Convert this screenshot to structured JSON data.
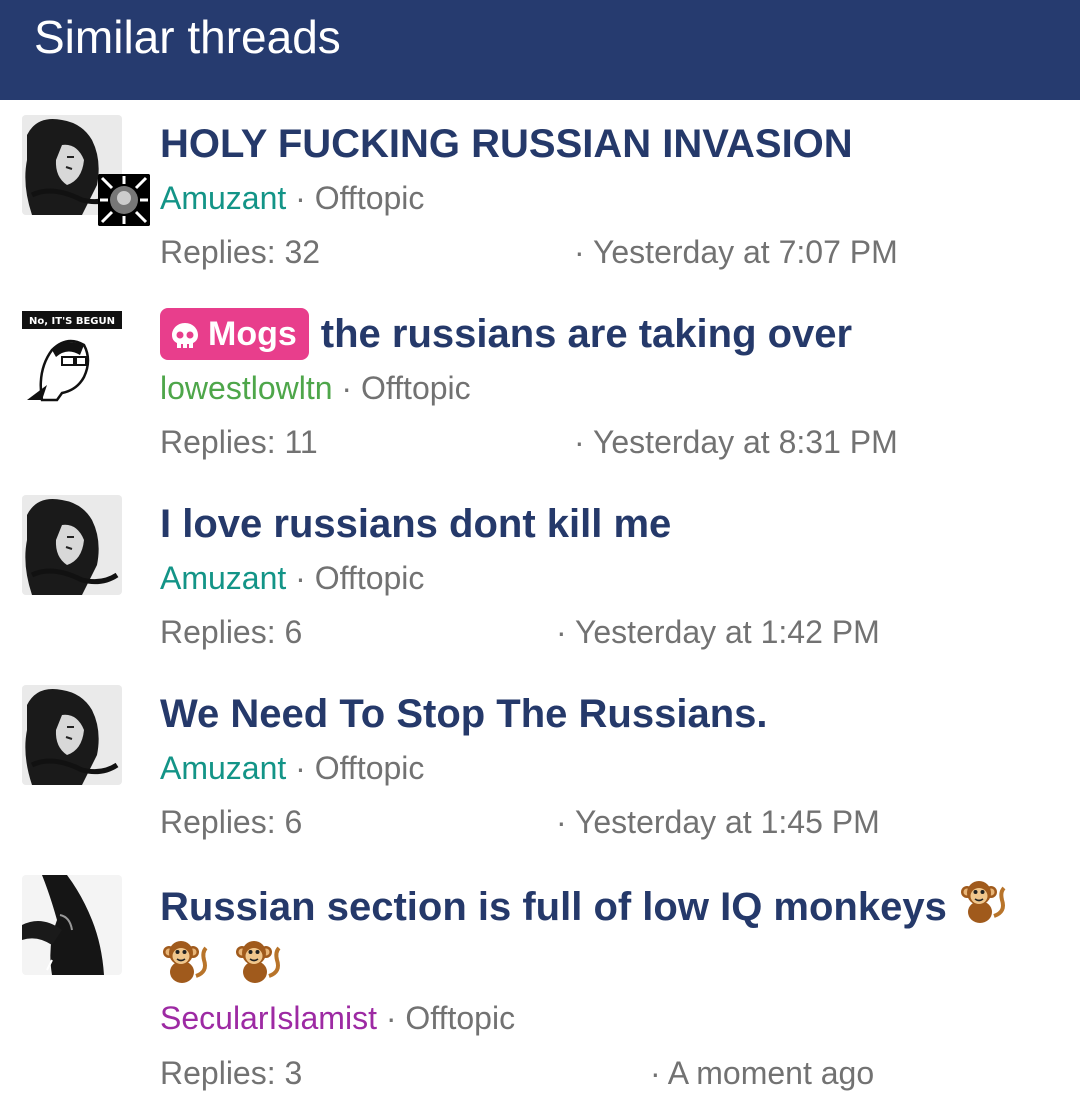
{
  "header": {
    "title": "Similar threads"
  },
  "threads": [
    {
      "prefix": "",
      "title": "HOLY FUCKING RUSSIAN INVASION",
      "author": "Amuzant",
      "sep": "·",
      "forum": "Offtopic",
      "replies": "Replies: 32",
      "date": "· Yesterday at 7:07 PM"
    },
    {
      "prefix": "Mogs",
      "title": "the russians are taking over",
      "author": "lowestlowltn",
      "sep": "·",
      "forum": "Offtopic",
      "replies": "Replies: 11",
      "date": "· Yesterday at 8:31 PM",
      "avatar_text": "No, IT'S BEGUN"
    },
    {
      "prefix": "",
      "title": "I love russians dont kill me",
      "author": "Amuzant",
      "sep": "·",
      "forum": "Offtopic",
      "replies": "Replies: 6",
      "date": "· Yesterday at 1:42 PM"
    },
    {
      "prefix": "",
      "title": "We Need To Stop The Russians.",
      "author": "Amuzant",
      "sep": "·",
      "forum": "Offtopic",
      "replies": "Replies: 6",
      "date": "· Yesterday at 1:45 PM"
    },
    {
      "prefix": "",
      "title": "Russian section is full of low IQ monkeys",
      "author": "SecularIslamist",
      "sep": "·",
      "forum": "Offtopic",
      "replies": "Replies: 3",
      "date": "· A moment ago"
    }
  ],
  "colors": {
    "header_bg": "#263b6f",
    "title": "#25396a",
    "prefix_bg": "#e83e8c",
    "author_teal": "#139487",
    "author_green": "#4ea64a",
    "author_purple": "#9d2aa3",
    "meta": "#727272"
  },
  "icons": [
    "skull-icon",
    "monkey-emoji-icon"
  ]
}
